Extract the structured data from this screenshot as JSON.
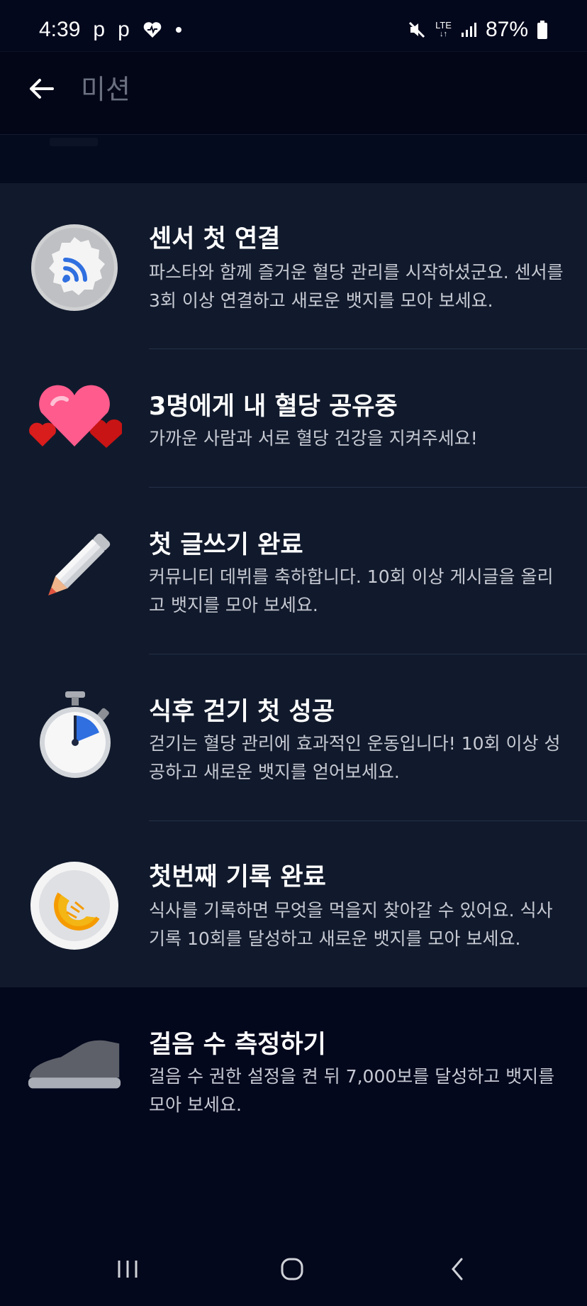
{
  "status_bar": {
    "time": "4:39",
    "notifications": [
      "p",
      "p"
    ],
    "network": "LTE",
    "battery": "87%"
  },
  "header": {
    "title": "미션"
  },
  "missions": [
    {
      "title": "센서 첫 연결",
      "description": "파스타와 함께 즐거운 혈당 관리를 시작하셨군요. 센서를 3회 이상 연결하고 새로운 뱃지를 모아 보세요.",
      "icon": "sensor-badge-icon"
    },
    {
      "title": "3명에게 내 혈당 공유중",
      "description": "가까운 사람과 서로 혈당 건강을 지켜주세요!",
      "icon": "hearts-icon"
    },
    {
      "title": "첫 글쓰기 완료",
      "description": "커뮤니티 데뷔를 축하합니다. 10회 이상 게시글을 올리고 뱃지를 모아 보세요.",
      "icon": "pencil-icon"
    },
    {
      "title": "식후 걷기 첫 성공",
      "description": "걷기는 혈당 관리에 효과적인 운동입니다! 10회 이상 성공하고 새로운 뱃지를 얻어보세요.",
      "icon": "stopwatch-icon"
    },
    {
      "title": "첫번째 기록 완료",
      "description": "식사를 기록하면 무엇을 먹을지 찾아갈 수 있어요. 식사 기록 10회를 달성하고 새로운 뱃지를 모아 보세요.",
      "icon": "meal-plate-icon"
    },
    {
      "title": "걸음 수 측정하기",
      "description": "걸음 수 권한 설정을 켠 뒤 7,000보를 달성하고 뱃지를 모아 보세요.",
      "icon": "sneaker-icon"
    }
  ],
  "colors": {
    "background": "#03081d",
    "panel": "#111a2c",
    "accent_blue": "#3b82f6"
  }
}
